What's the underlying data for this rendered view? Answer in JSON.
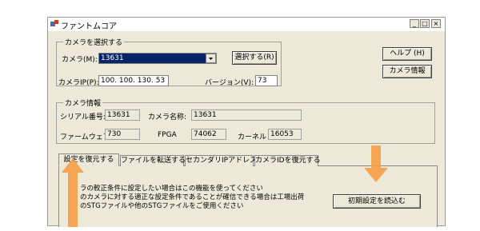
{
  "window": {
    "title": "ファントムコア",
    "minimize": "_",
    "maximize": "□",
    "close": "×"
  },
  "camera_select": {
    "legend": "カメラを選択する",
    "camera_label": "カメラ(M):",
    "camera_value": "13631",
    "select_button": "選択する(R)",
    "ip_label": "カメラIP(P):",
    "ip_value": "100. 100. 130. 53",
    "version_label": "バージョン(V):",
    "version_value": "73"
  },
  "side_buttons": {
    "help": "ヘルプ (H)",
    "camera_info": "カメラ情報"
  },
  "camera_info": {
    "legend": "カメラ情報",
    "serial_label": "シリアル番号:",
    "serial_value": "13631",
    "name_label": "カメラ名称:",
    "name_value": "13631",
    "firmware_label": "ファームウェア",
    "firmware_value": "730",
    "fpga_label": "FPGA",
    "fpga_value": "74062",
    "kernel_label": "カーネル",
    "kernel_value": "16053"
  },
  "tabs": [
    {
      "label": "設定を復元する",
      "active": true
    },
    {
      "label": "ファイルを転送する",
      "active": false
    },
    {
      "label": "セカンダリIPアドレス",
      "active": false
    },
    {
      "label": "カメラIDを復元する",
      "active": false
    }
  ],
  "restore_panel": {
    "line1": "ラの較正条件に設定したい場合はこの機能を使ってください",
    "line2": "のカメラに対する適正な設定条件であることが確信できる場合は工場出荷",
    "line3": "のSTGファイルや他のSTGファイルをご使用ください",
    "load_button": "初期設定を読込む"
  },
  "colors": {
    "arrow": "#f5a04a",
    "selected_field": "#0a246a",
    "window_bg": "#ece9d8"
  }
}
